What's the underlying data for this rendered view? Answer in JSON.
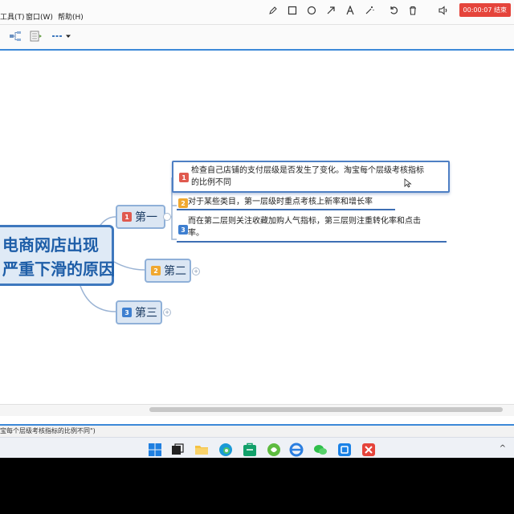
{
  "menu": {
    "tools": "工具(T)",
    "window": "窗口(W)",
    "help": "帮助(H)"
  },
  "recorder": {
    "tools": [
      "pen-icon",
      "rectangle-icon",
      "circle-icon",
      "arrow-icon",
      "text-icon",
      "magic-wand-icon",
      "undo-icon",
      "trash-icon",
      "speaker-icon",
      "microphone-icon",
      "close-icon"
    ],
    "timer": "00:00:07 结束",
    "timer_color": "#e5443b"
  },
  "toolbar": {
    "tools": [
      "structure-icon",
      "outline-icon",
      "line-style-icon",
      "dropdown-icon"
    ]
  },
  "mindmap": {
    "central_line1": "电商网店出现",
    "central_line2": "严重下滑的原因",
    "branches": [
      {
        "number": "1",
        "label": "第一",
        "badge_color": "#e05a4f"
      },
      {
        "number": "2",
        "label": "第二",
        "badge_color": "#f0a830"
      },
      {
        "number": "3",
        "label": "第三",
        "badge_color": "#3e7fd0"
      }
    ],
    "leaves": [
      {
        "number": "1",
        "line1": "检查自己店铺的支付层级是否发生了变化。淘宝每个层级考核指标",
        "line2": "的比例不同",
        "badge_color": "#e05a4f"
      },
      {
        "number": "2",
        "line1": "对于某些类目，第一层级时重点考核上新率和增长率",
        "badge_color": "#f0a830"
      },
      {
        "number": "3",
        "line1": "而在第二层则关注收藏加购人气指标，第三层则注重转化率和点击",
        "line2": "率。",
        "badge_color": "#3e7fd0"
      }
    ]
  },
  "status": {
    "text": "宝每个层级考核指标的比例不同\")"
  },
  "taskbar": {
    "apps": [
      "windows-start-icon",
      "task-view-icon",
      "file-explorer-icon",
      "edge-icon",
      "store-icon",
      "app-icon",
      "ie-icon",
      "wechat-icon",
      "xmind-icon",
      "recorder-app-icon"
    ],
    "chevron": "^"
  }
}
